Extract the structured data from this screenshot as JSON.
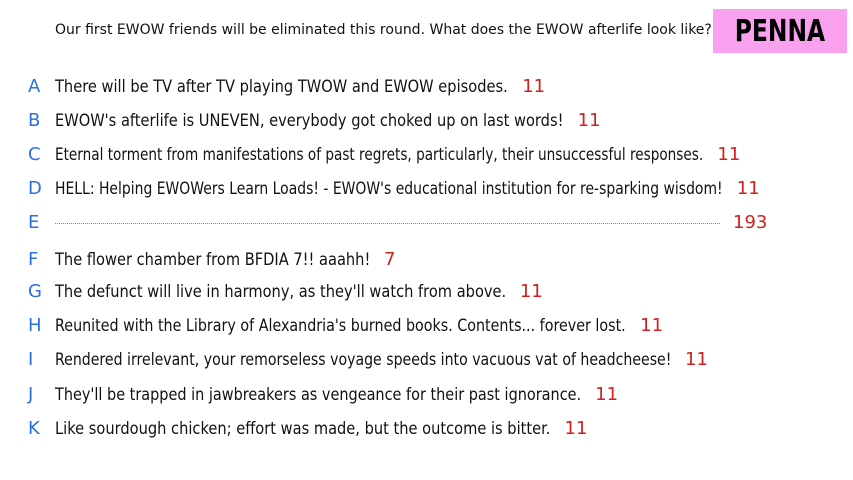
{
  "prompt": "Our first EWOW friends will be eliminated this round. What does the EWOW afterlife look like?",
  "name_tag": {
    "label": "PENNA",
    "color": "#f9a0ee"
  },
  "colors": {
    "letter": "#2b6fe0",
    "count": "#d02020",
    "text": "#111111"
  },
  "responses": [
    {
      "letter": "A",
      "text": "There will be TV after TV playing TWOW and EWOW episodes.",
      "count": "11"
    },
    {
      "letter": "B",
      "text": "EWOW's afterlife is UNEVEN, everybody got choked up on last words!",
      "count": "11"
    },
    {
      "letter": "C",
      "text": "Eternal torment from manifestations of past regrets, particularly, their unsuccessful responses.",
      "count": "11"
    },
    {
      "letter": "D",
      "text": "HELL: Helping EWOWers Learn Loads! - EWOW's educational institution for re-sparking wisdom!",
      "count": "11"
    },
    {
      "letter": "E",
      "text": "",
      "count": "193"
    },
    {
      "letter": "F",
      "text": "The flower chamber from BFDIA 7!! aaahh!",
      "count": "7"
    },
    {
      "letter": "G",
      "text": "The defunct will live in harmony, as they'll watch from above.",
      "count": "11"
    },
    {
      "letter": "H",
      "text": "Reunited with the Library of Alexandria's burned books. Contents... forever lost.",
      "count": "11"
    },
    {
      "letter": "I",
      "text": "Rendered irrelevant, your remorseless voyage speeds into vacuous vat of headcheese!",
      "count": "11"
    },
    {
      "letter": "J",
      "text": "They'll be trapped in jawbreakers as vengeance for their past ignorance.",
      "count": "11"
    },
    {
      "letter": "K",
      "text": "Like sourdough chicken; effort was made, but the outcome is bitter.",
      "count": "11"
    }
  ]
}
